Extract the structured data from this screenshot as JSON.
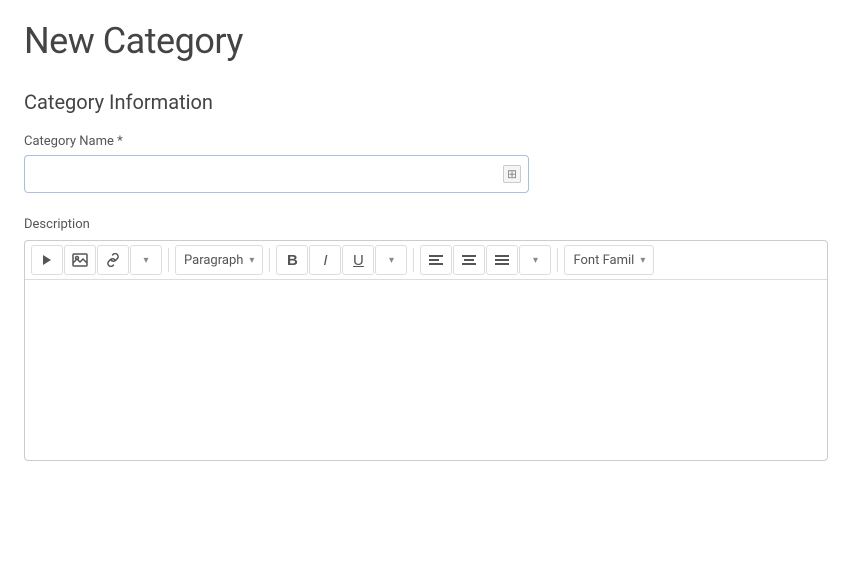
{
  "page": {
    "title": "New Category",
    "section_title": "Category Information",
    "category_name_label": "Category Name",
    "category_name_required": true,
    "category_name_placeholder": "",
    "description_label": "Description"
  },
  "toolbar": {
    "paragraph_label": "Paragraph",
    "font_family_label": "Font Famil",
    "bold_label": "B",
    "italic_label": "I",
    "underline_label": "U",
    "chevron_down": "▾",
    "video_icon": "▶",
    "image_icon": "📷",
    "link_icon": "🔗",
    "align_left_icon": "≡",
    "align_center_icon": "≡",
    "align_justify_icon": "≡"
  }
}
